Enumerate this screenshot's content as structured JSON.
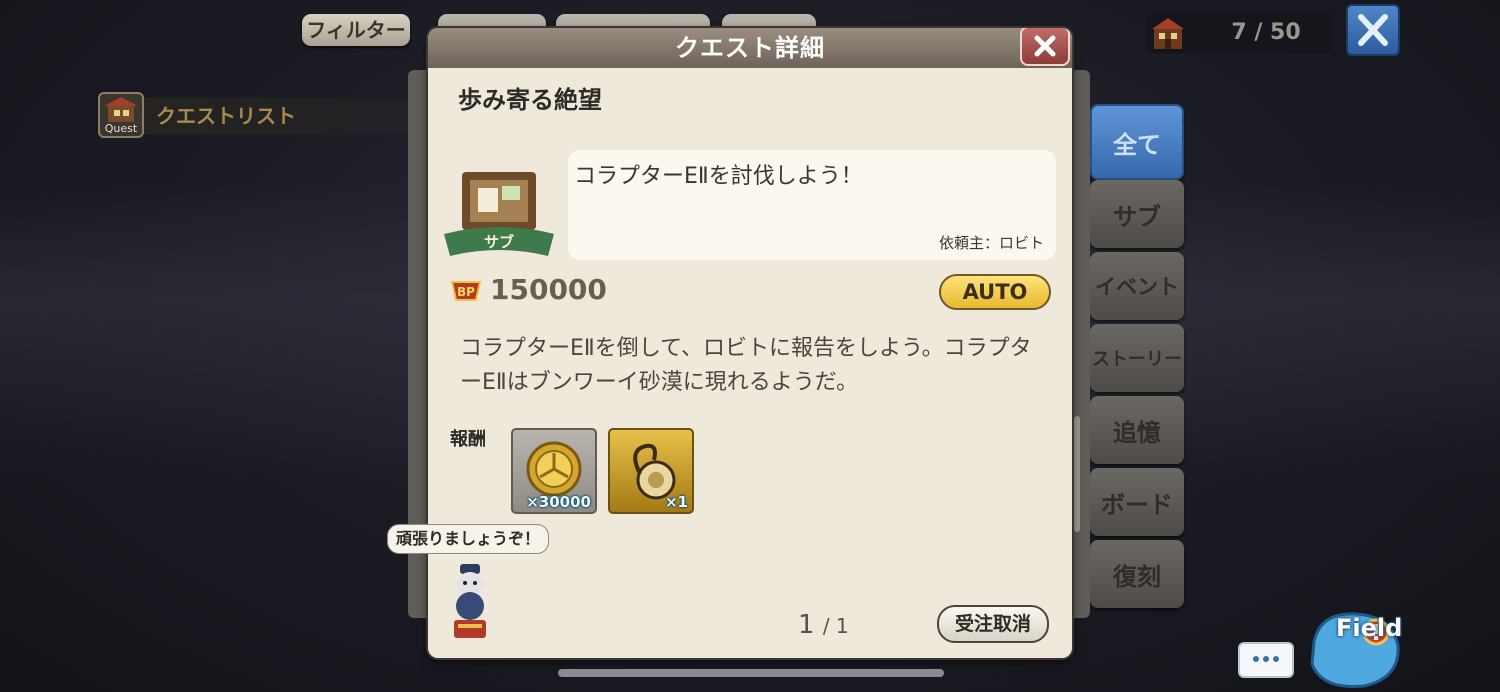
{
  "top_bar": {
    "filter_label": "フィルター",
    "counter": "7 / 50"
  },
  "quest_list": {
    "icon_text": "Quest",
    "label": "クエストリスト"
  },
  "tabs": [
    "全て",
    "サブ",
    "イベント",
    "ストーリー",
    "追憶",
    "ボード",
    "復刻"
  ],
  "dialog": {
    "title": "クエスト詳細",
    "quest_name": "歩み寄る絶望",
    "category": "サブ",
    "summary": "コラプターEⅡを討伐しよう！",
    "client": "依頼主：ロビト",
    "bp_label": "BP",
    "bp_value": "150000",
    "auto_label": "AUTO",
    "description": "コラプターEⅡを倒して、ロビトに報告をしよう。コラプターEⅡはブンワーイ砂漠に現れるようだ。",
    "reward_label": "報酬",
    "rewards": [
      {
        "icon": "gil-coin-icon",
        "qty": "×30000"
      },
      {
        "icon": "ring-accessory-icon",
        "qty": "×1"
      }
    ],
    "mascot_speech": "頑張りましょうぞ！",
    "page_current": "1",
    "page_total": "/ 1",
    "cancel_label": "受注取消"
  },
  "field_button": {
    "label": "Field"
  },
  "colors": {
    "active_tab": "#4a80c2",
    "dialog_bg": "#efe9dc",
    "auto_button": "#f2c94c"
  }
}
